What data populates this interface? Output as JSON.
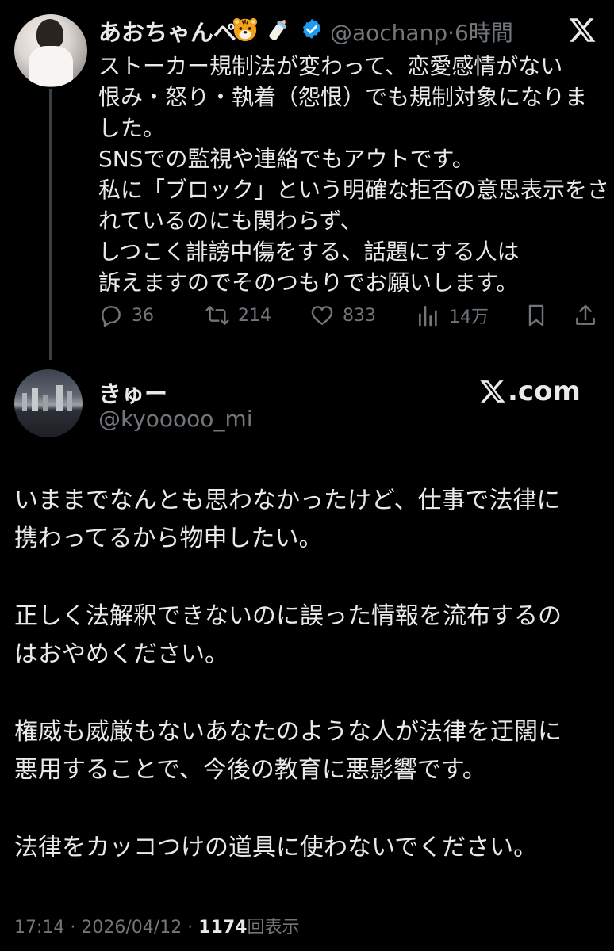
{
  "parent_tweet": {
    "display_name": "あおちゃんぺ",
    "emojis": [
      "tiger-face-emoji",
      "baby-bottle-emoji"
    ],
    "handle": "@aochanp",
    "separator": "·",
    "time_ago": "6時間",
    "body_lines": [
      "ストーカー規制法が変わって、恋愛感情がない",
      "恨み・怒り・執着（怨恨）でも規制対象になりま",
      "した。",
      "SNSでの監視や連絡でもアウトです。",
      "私に「ブロック」という明確な拒否の意思表示をさ",
      "れているのにも関わらず、",
      "しつこく誹謗中傷をする、話題にする人は",
      "訴えますのでそのつもりでお願いします。"
    ],
    "stats": {
      "replies": "36",
      "retweets": "214",
      "likes": "833",
      "views": "14万"
    }
  },
  "quote_tweet": {
    "display_name": "きゅー",
    "handle": "@kyooooo_mi",
    "site_label": ".com",
    "paragraphs": [
      [
        "いままでなんとも思わなかったけど、仕事で法律に",
        "携わってるから物申したい。"
      ],
      [
        "正しく法解釈できないのに誤った情報を流布するの",
        "はおやめください。"
      ],
      [
        "権威も威厳もないあなたのような人が法律を迂闊に",
        "悪用することで、今後の教育に悪影響です。"
      ],
      [
        "法律をカッコつけの道具に使わないでください。"
      ]
    ],
    "time": "17:14",
    "date": "2026/04/12",
    "separator": "·",
    "view_count": "1174",
    "view_label": "回表示"
  },
  "colors": {
    "background": "#000000",
    "text": "#e7e9ea",
    "muted": "#71767b",
    "verified": "#1d9bf0",
    "thread_line": "#3a3d41"
  }
}
